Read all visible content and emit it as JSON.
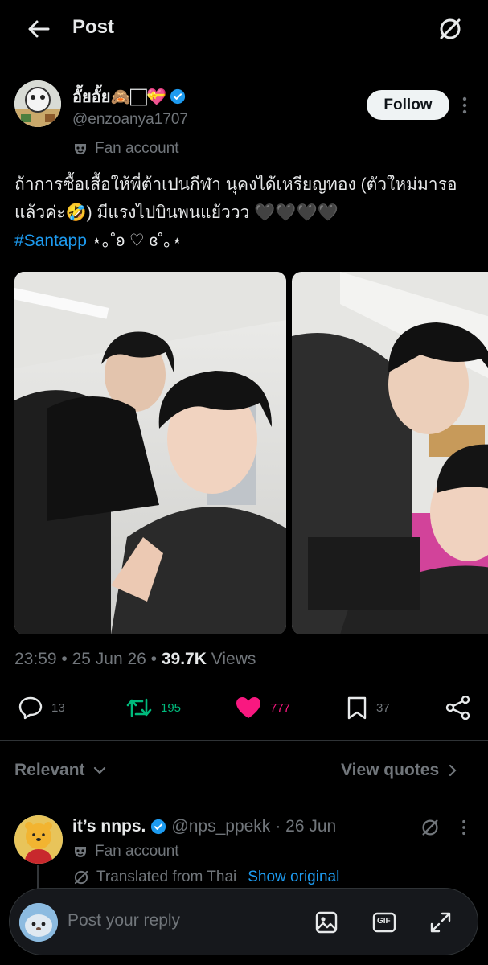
{
  "header": {
    "title": "Post"
  },
  "post": {
    "author_name": "อั้ยอั้ย🙈🏻💝",
    "author_handle": "@enzoanya1707",
    "follow_label": "Follow",
    "fan_label": "Fan account",
    "text_main": "ถ้าการซื้อเสื้อให้พี่ต้าเปนกีฬา นุคงได้เหรียญทอง (ตัวใหม่มารอแล้วค่ะ🤣) มีแรงไปบินพนแย้ววว 🖤🖤🖤🖤",
    "hashtag": "#Santapp",
    "text_tail": " ⋆｡˚ʚ ♡ ɞ˚｡⋆",
    "time": "23:59 • 25 Jun 26 • ",
    "views_count": "39.7K",
    "views_label": " Views"
  },
  "actions": {
    "replies": "13",
    "reposts": "195",
    "likes": "777",
    "bookmarks": "37"
  },
  "sort": {
    "relevant": "Relevant",
    "view_quotes": "View quotes"
  },
  "reply": {
    "name": "it’s nnps.",
    "handle": "@nps_ppekk",
    "date": "· 26 Jun",
    "fan_label": "Fan account",
    "translated": "Translated from Thai",
    "show_original": "Show original"
  },
  "composer": {
    "placeholder": "Post your reply",
    "gif_label": "GIF"
  },
  "colors": {
    "accent": "#1d9bf0",
    "repost": "#00ba7c",
    "like": "#f91880",
    "muted": "#71767b"
  }
}
